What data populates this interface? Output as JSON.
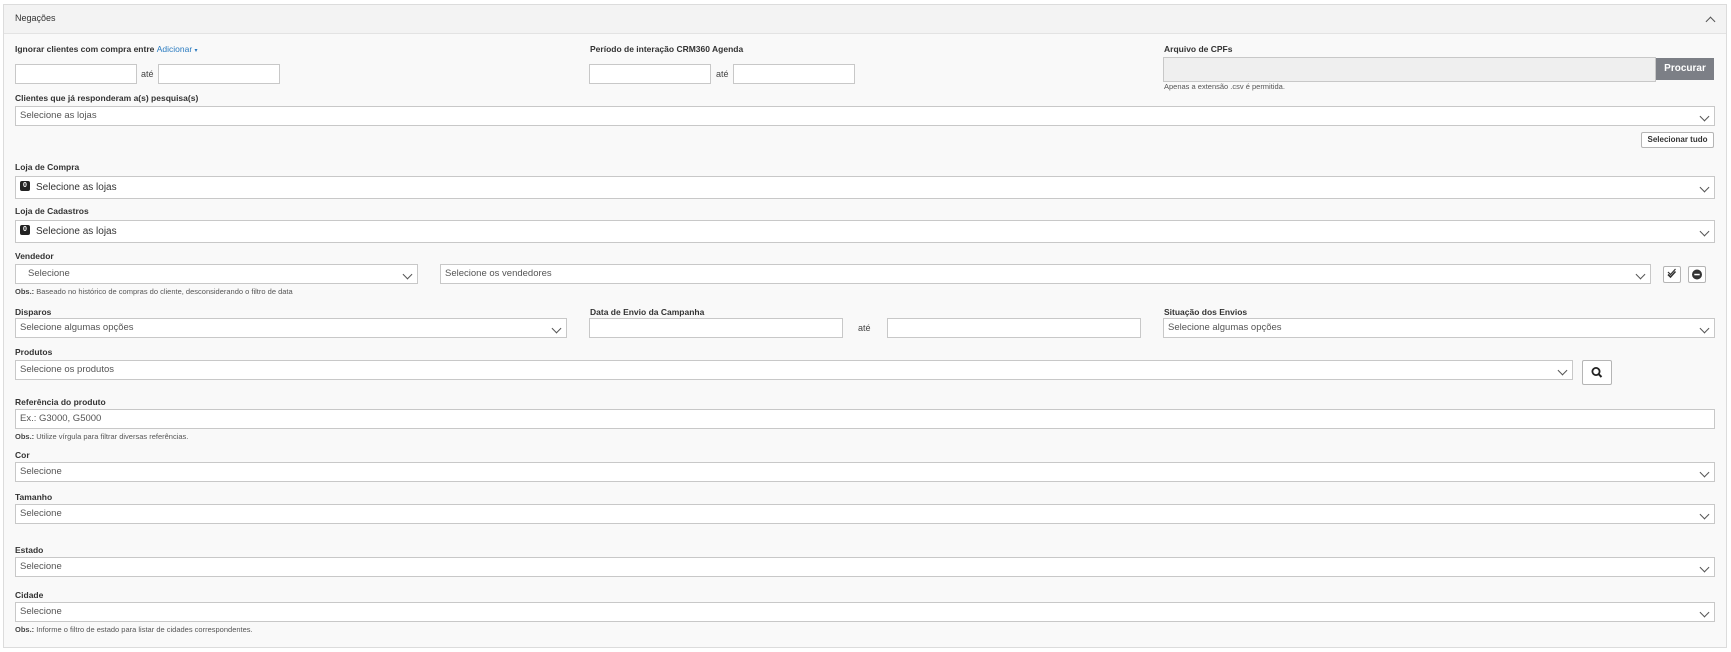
{
  "panel": {
    "title": "Negações"
  },
  "ignore_purchase": {
    "label": "Ignorar clientes com compra entre",
    "add_link": "Adicionar",
    "add_caret": "▾",
    "from": "",
    "to": "",
    "sep": "até"
  },
  "crm_period": {
    "label": "Período de interação CRM360 Agenda",
    "from": "",
    "to": "",
    "sep": "até"
  },
  "cpf_file": {
    "label": "Arquivo de CPFs",
    "value": "",
    "button": "Procurar",
    "note": "Apenas a extensão .csv é permitida."
  },
  "surveys": {
    "label": "Clientes que já responderam a(s) pesquisa(s)",
    "placeholder": "Selecione as lojas",
    "select_all": "Selecionar tudo"
  },
  "purchase_store": {
    "label": "Loja de Compra",
    "count": "0",
    "placeholder": "Selecione as lojas"
  },
  "register_store": {
    "label": "Loja de Cadastros",
    "count": "0",
    "placeholder": "Selecione as lojas"
  },
  "seller": {
    "label": "Vendedor",
    "type_placeholder": "Selecione",
    "sellers_placeholder": "Selecione os vendedores",
    "note_bold": "Obs.:",
    "note": " Baseado no histórico de compras do cliente, desconsiderando o filtro de data"
  },
  "dispatches": {
    "label": "Disparos",
    "placeholder": "Selecione algumas opções"
  },
  "send_date": {
    "label": "Data de Envio da Campanha",
    "from": "",
    "to": "",
    "sep": "até"
  },
  "send_status": {
    "label": "Situação dos Envios",
    "placeholder": "Selecione algumas opções"
  },
  "products": {
    "label": "Produtos",
    "placeholder": "Selecione os produtos"
  },
  "product_ref": {
    "label": "Referência do produto",
    "placeholder": "Ex.: G3000, G5000",
    "note_bold": "Obs.:",
    "note": " Utilize vírgula para filtrar diversas referências."
  },
  "color": {
    "label": "Cor",
    "placeholder": "Selecione"
  },
  "size": {
    "label": "Tamanho",
    "placeholder": "Selecione"
  },
  "state": {
    "label": "Estado",
    "placeholder": "Selecione"
  },
  "city": {
    "label": "Cidade",
    "placeholder": "Selecione",
    "note_bold": "Obs.:",
    "note": " Informe o filtro de estado para listar de cidades correspondentes."
  },
  "colors": {
    "accent": "#2a7bc0",
    "button_gray": "#7c7f86",
    "border": "#c8c8c8"
  }
}
